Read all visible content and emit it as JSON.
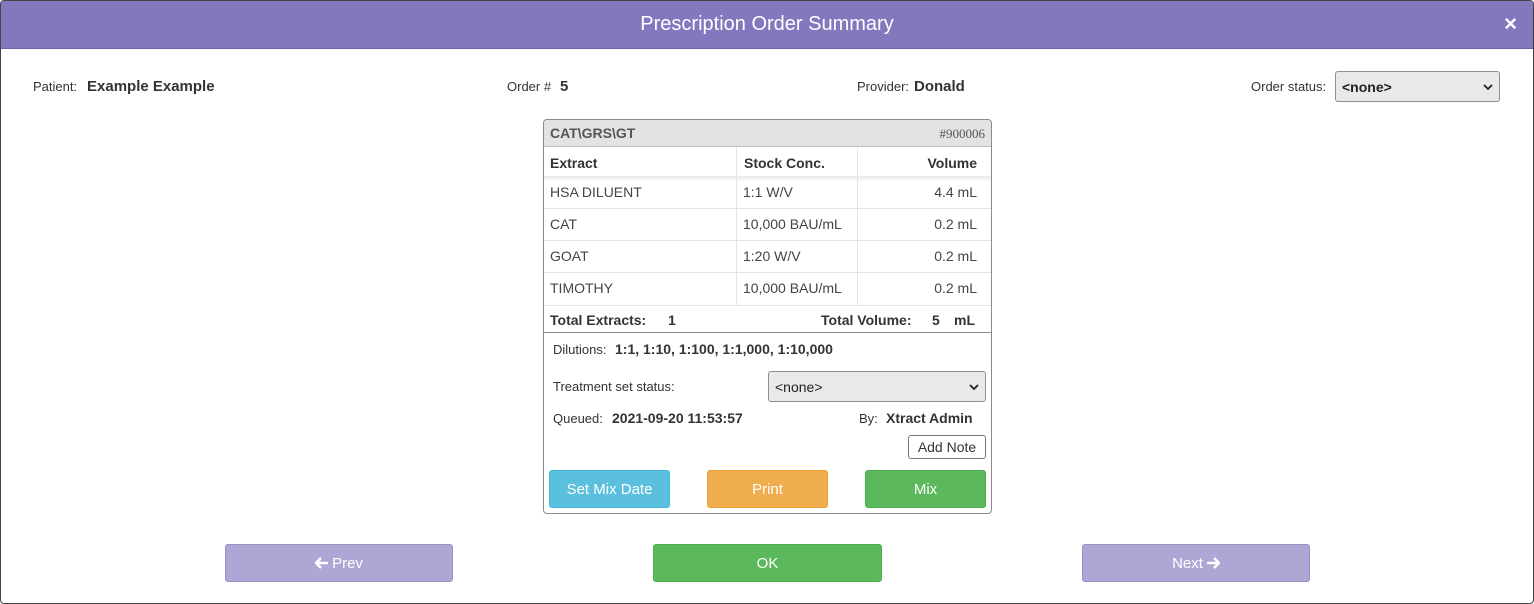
{
  "dialog": {
    "title": "Prescription Order Summary",
    "close_label": "×"
  },
  "header": {
    "patient_label": "Patient:",
    "patient_value": "Example Example",
    "order_label": "Order #",
    "order_value": "5",
    "provider_label": "Provider:",
    "provider_value": "Donald",
    "status_label": "Order status:",
    "status_value": "<none>"
  },
  "card": {
    "name": "CAT\\GRS\\GT",
    "id": "#900006",
    "columns": [
      "Extract",
      "Stock Conc.",
      "Volume"
    ],
    "rows": [
      {
        "extract": "HSA DILUENT",
        "conc": "1:1 W/V",
        "volume": "4.4 mL"
      },
      {
        "extract": "CAT",
        "conc": "10,000 BAU/mL",
        "volume": "0.2 mL"
      },
      {
        "extract": "GOAT",
        "conc": "1:20 W/V",
        "volume": "0.2 mL"
      },
      {
        "extract": "TIMOTHY",
        "conc": "10,000 BAU/mL",
        "volume": "0.2 mL"
      }
    ],
    "total_extracts_label": "Total Extracts:",
    "total_extracts_value": "1",
    "total_volume_label": "Total Volume:",
    "total_volume_value": "5",
    "total_volume_unit": "mL",
    "dilutions_label": "Dilutions:",
    "dilutions_value": "1:1, 1:10, 1:100, 1:1,000, 1:10,000",
    "treatment_label": "Treatment set status:",
    "treatment_value": "<none>",
    "queued_label": "Queued:",
    "queued_value": "2021-09-20 11:53:57",
    "by_label": "By:",
    "by_value": "Xtract Admin",
    "add_note_label": "Add Note",
    "set_mix_date_label": "Set Mix Date",
    "print_label": "Print",
    "mix_label": "Mix"
  },
  "footer": {
    "prev_label": "Prev",
    "ok_label": "OK",
    "next_label": "Next"
  },
  "colors": {
    "title_bar": "#8477bd",
    "prev_next": "#b0a6d5",
    "ok": "#5cb85c",
    "set_mix_date": "#5bc0de",
    "print": "#f0ad4e",
    "mix": "#5cb85c"
  }
}
